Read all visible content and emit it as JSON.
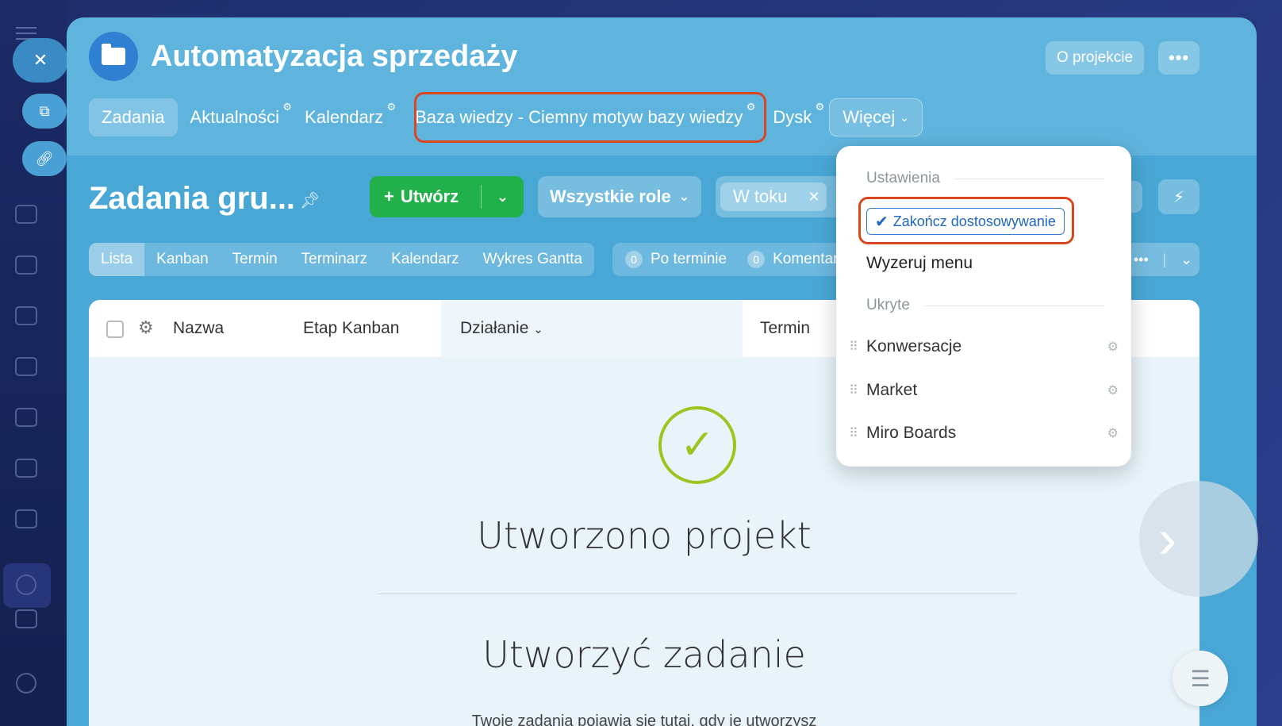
{
  "project": {
    "title": "Automatyzacja sprzedaży",
    "about_label": "O projekcie",
    "more_label": "•••"
  },
  "tabs": [
    {
      "label": "Zadania"
    },
    {
      "label": "Aktualności"
    },
    {
      "label": "Kalendarz"
    },
    {
      "label": "Baza wiedzy - Ciemny motyw bazy wiedzy"
    },
    {
      "label": "Dysk"
    },
    {
      "label": "Więcej"
    }
  ],
  "toolbar": {
    "section_title": "Zadania gru...",
    "create_label": "Utwórz",
    "roles_label": "Wszystkie role",
    "filter_chip": "W toku"
  },
  "views": [
    "Lista",
    "Kanban",
    "Termin",
    "Terminarz",
    "Kalendarz",
    "Wykres Gantta"
  ],
  "counters": [
    {
      "count": "0",
      "label": "Po terminie"
    },
    {
      "count": "0",
      "label": "Komentarze"
    }
  ],
  "table": {
    "columns": [
      "Nazwa",
      "Etap Kanban",
      "Działanie",
      "Termin"
    ]
  },
  "empty_state": {
    "heading": "Utworzono projekt",
    "subheading": "Utworzyć zadanie",
    "body": "Twoje zadania pojawią się tutaj, gdy je utworzysz"
  },
  "menu": {
    "settings_header": "Ustawienia",
    "finish_label": "Zakończ dostosowywanie",
    "reset_label": "Wyzeruj menu",
    "hidden_header": "Ukryte",
    "hidden_items": [
      "Konwersacje",
      "Market",
      "Miro Boards"
    ]
  },
  "colors": {
    "panel": "#5fb4de",
    "create_green": "#22b04a",
    "highlight_red": "#d9471f",
    "check_green": "#9cc61f",
    "link_blue": "#2167c0"
  }
}
